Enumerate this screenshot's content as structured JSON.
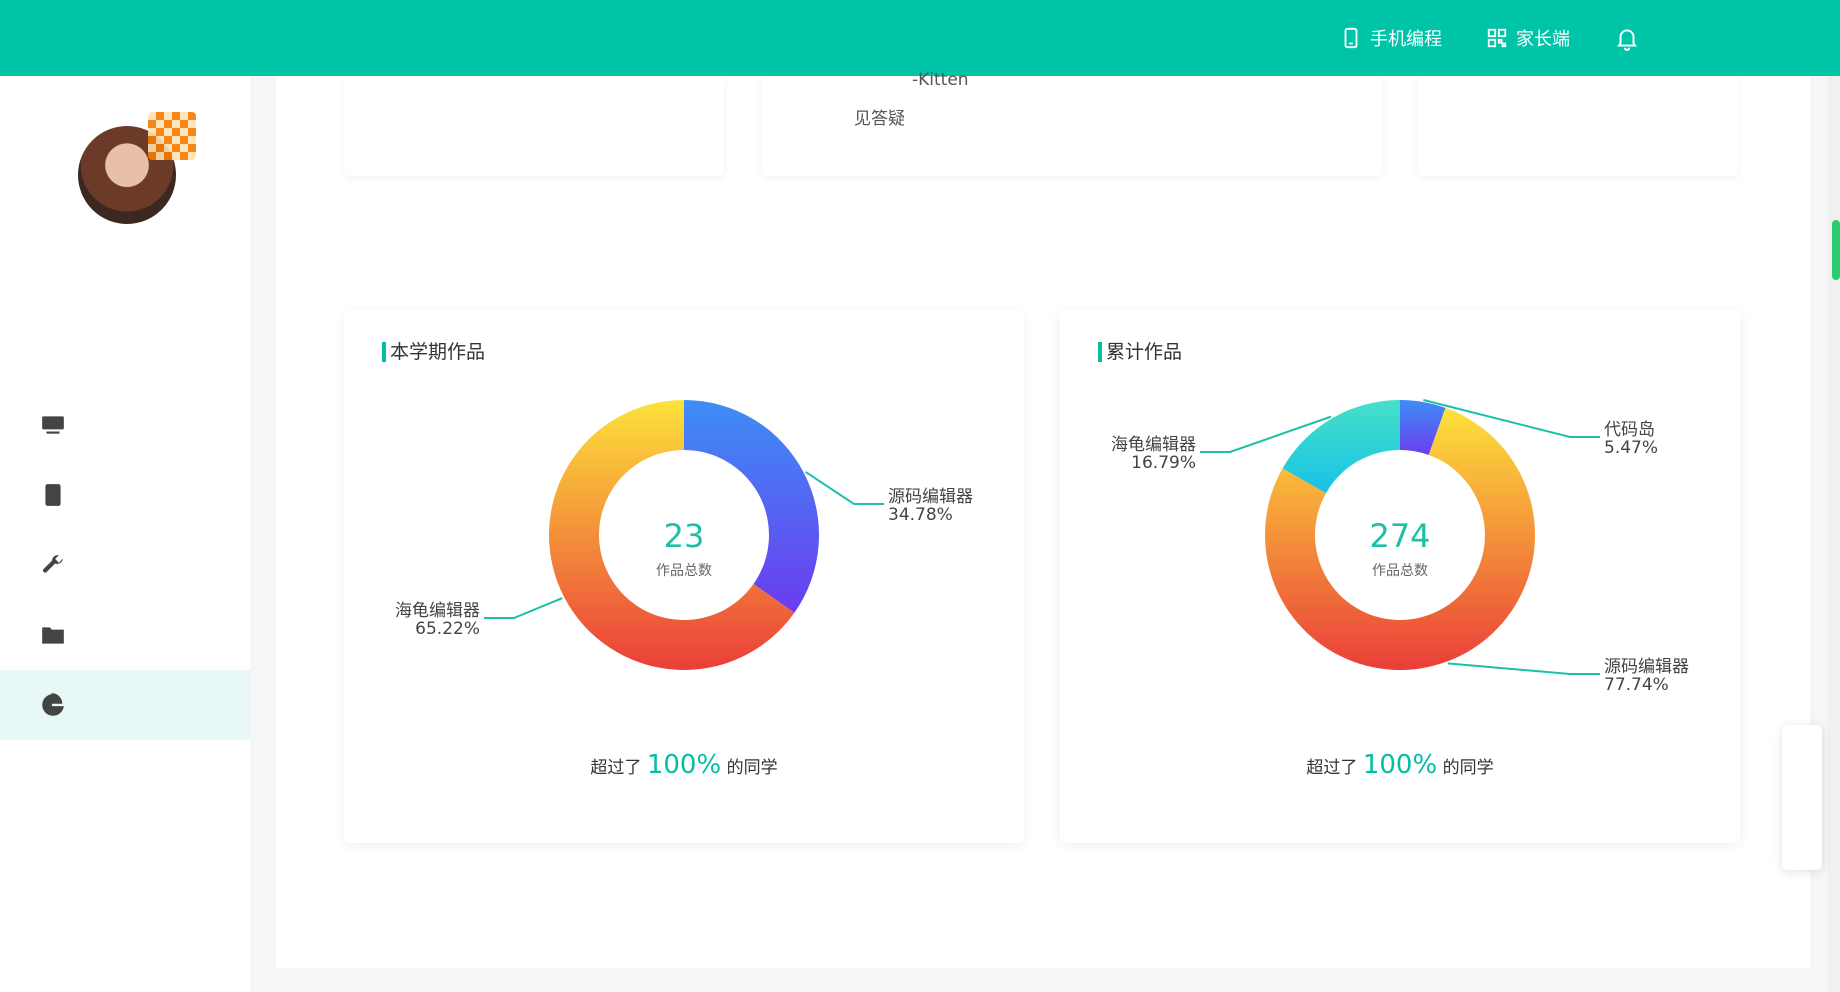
{
  "header": {
    "mobile_coding": "手机编程",
    "parent_app": "家长端",
    "icons": {
      "mobile": "mobile-phone-icon",
      "parent": "qr-grid-icon",
      "bell": "bell-icon"
    }
  },
  "stat_cards": {
    "card2_line1": "-Kitten",
    "card2_line2": "见答疑"
  },
  "charts": [
    {
      "title": "本学期作品",
      "total": "23",
      "total_label": "作品总数",
      "footer_prefix": "超过了",
      "footer_pct": "100%",
      "footer_suffix": "的同学",
      "labels": [
        {
          "name": "源码编辑器",
          "pct": "34.78%"
        },
        {
          "name": "海龟编辑器",
          "pct": "65.22%"
        }
      ]
    },
    {
      "title": "累计作品",
      "total": "274",
      "total_label": "作品总数",
      "footer_prefix": "超过了",
      "footer_pct": "100%",
      "footer_suffix": "的同学",
      "labels": [
        {
          "name": "代码岛",
          "pct": "5.47%"
        },
        {
          "name": "海龟编辑器",
          "pct": "16.79%"
        },
        {
          "name": "源码编辑器",
          "pct": "77.74%"
        }
      ]
    }
  ],
  "chart_data": [
    {
      "type": "pie",
      "title": "本学期作品",
      "categories": [
        "源码编辑器",
        "海龟编辑器"
      ],
      "values": [
        34.78,
        65.22
      ],
      "total": 23
    },
    {
      "type": "pie",
      "title": "累计作品",
      "categories": [
        "代码岛",
        "源码编辑器",
        "海龟编辑器"
      ],
      "values": [
        5.47,
        77.74,
        16.79
      ],
      "total": 274
    }
  ]
}
